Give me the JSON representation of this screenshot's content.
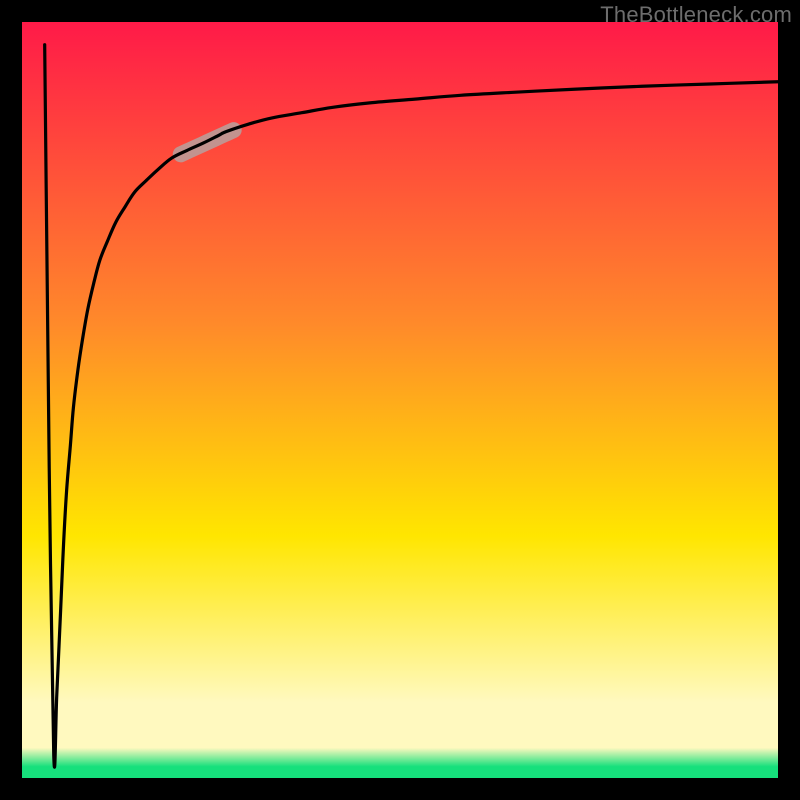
{
  "watermark": {
    "text": "TheBottleneck.com"
  },
  "colors": {
    "gradient_top": "#ff1a48",
    "gradient_mid_orange": "#ff8a2a",
    "gradient_mid_yellow": "#ffe600",
    "gradient_band_pale": "#fff9bf",
    "gradient_green": "#16e07c",
    "frame": "#000000",
    "curve": "#000000",
    "highlight": "#c2938f"
  },
  "chart_data": {
    "type": "line",
    "title": "",
    "xlabel": "",
    "ylabel": "",
    "xlim": [
      0,
      100
    ],
    "ylim": [
      0,
      100
    ],
    "series": [
      {
        "name": "curve",
        "x": [
          3.0,
          3.2,
          3.6,
          4.2,
          4.6,
          5.1,
          5.5,
          5.9,
          6.4,
          6.8,
          7.4,
          8.0,
          8.7,
          9.5,
          10.3,
          11.3,
          12.4,
          13.6,
          14.9,
          16.4,
          18.0,
          19.8,
          21.8,
          24.0,
          26.0,
          27.0,
          30.0,
          33.0,
          37.0,
          41.0,
          46.0,
          52.0,
          58.0,
          65.0,
          73.0,
          82.0,
          91.0,
          100.0
        ],
        "y": [
          97.0,
          78.0,
          41.0,
          3.0,
          11.0,
          22.0,
          31.0,
          38.0,
          44.0,
          49.0,
          54.0,
          58.0,
          62.0,
          65.5,
          68.5,
          71.0,
          73.5,
          75.5,
          77.5,
          79.0,
          80.5,
          82.0,
          83.0,
          84.0,
          85.0,
          85.5,
          86.5,
          87.3,
          88.0,
          88.7,
          89.3,
          89.8,
          90.3,
          90.7,
          91.1,
          91.5,
          91.8,
          92.1
        ]
      }
    ],
    "annotations": [
      {
        "name": "highlight-segment",
        "x_range": [
          21.0,
          28.0
        ],
        "y_range": [
          82.5,
          85.7
        ],
        "note": "thick muted-rose stroke over a short segment of the curve"
      }
    ],
    "background": {
      "type": "vertical-gradient",
      "stops": [
        {
          "pos": 0.0,
          "color_ref": "gradient_top"
        },
        {
          "pos": 0.4,
          "color_ref": "gradient_mid_orange"
        },
        {
          "pos": 0.68,
          "color_ref": "gradient_mid_yellow"
        },
        {
          "pos": 0.9,
          "color_ref": "gradient_band_pale"
        },
        {
          "pos": 0.985,
          "color_ref": "gradient_green"
        }
      ]
    }
  }
}
